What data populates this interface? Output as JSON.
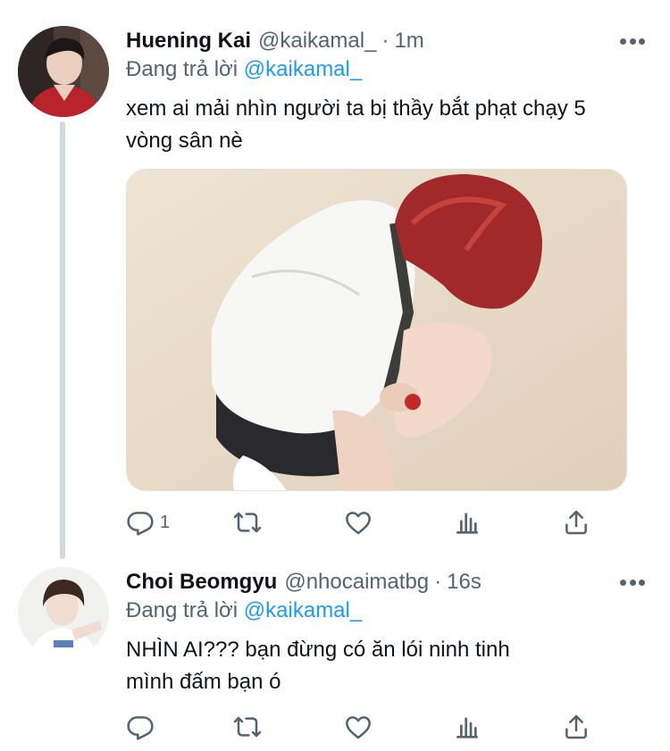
{
  "tweets": [
    {
      "name": "Huening Kai",
      "handle": "@kaikamal_",
      "separator": "·",
      "time": "1m",
      "replying_prefix": "Đang trả lời",
      "replying_to": "@kaikamal_",
      "text_lines": [
        "xem ai mải nhìn người ta bị thầy bắt phạt chạy 5",
        "vòng sân nè"
      ],
      "has_media": true,
      "reply_count": "1",
      "retweet_count": "",
      "like_count": ""
    },
    {
      "name": "Choi Beomgyu",
      "handle": "@nhocaimatbg",
      "separator": "·",
      "time": "16s",
      "replying_prefix": "Đang trả lời",
      "replying_to": "@kaikamal_",
      "text_lines": [
        "NHÌN AI??? bạn đừng có ăn lói ninh tinh",
        "mình đấm bạn ó"
      ],
      "has_media": false,
      "reply_count": "",
      "retweet_count": "",
      "like_count": ""
    }
  ],
  "icons": {
    "reply": "reply-icon",
    "retweet": "retweet-icon",
    "like": "heart-icon",
    "analytics": "analytics-icon",
    "share": "share-icon",
    "more": "more-icon"
  },
  "colors": {
    "mention": "#1d9bf0",
    "secondary_text": "#536471",
    "thread_line": "#cfd9de"
  }
}
